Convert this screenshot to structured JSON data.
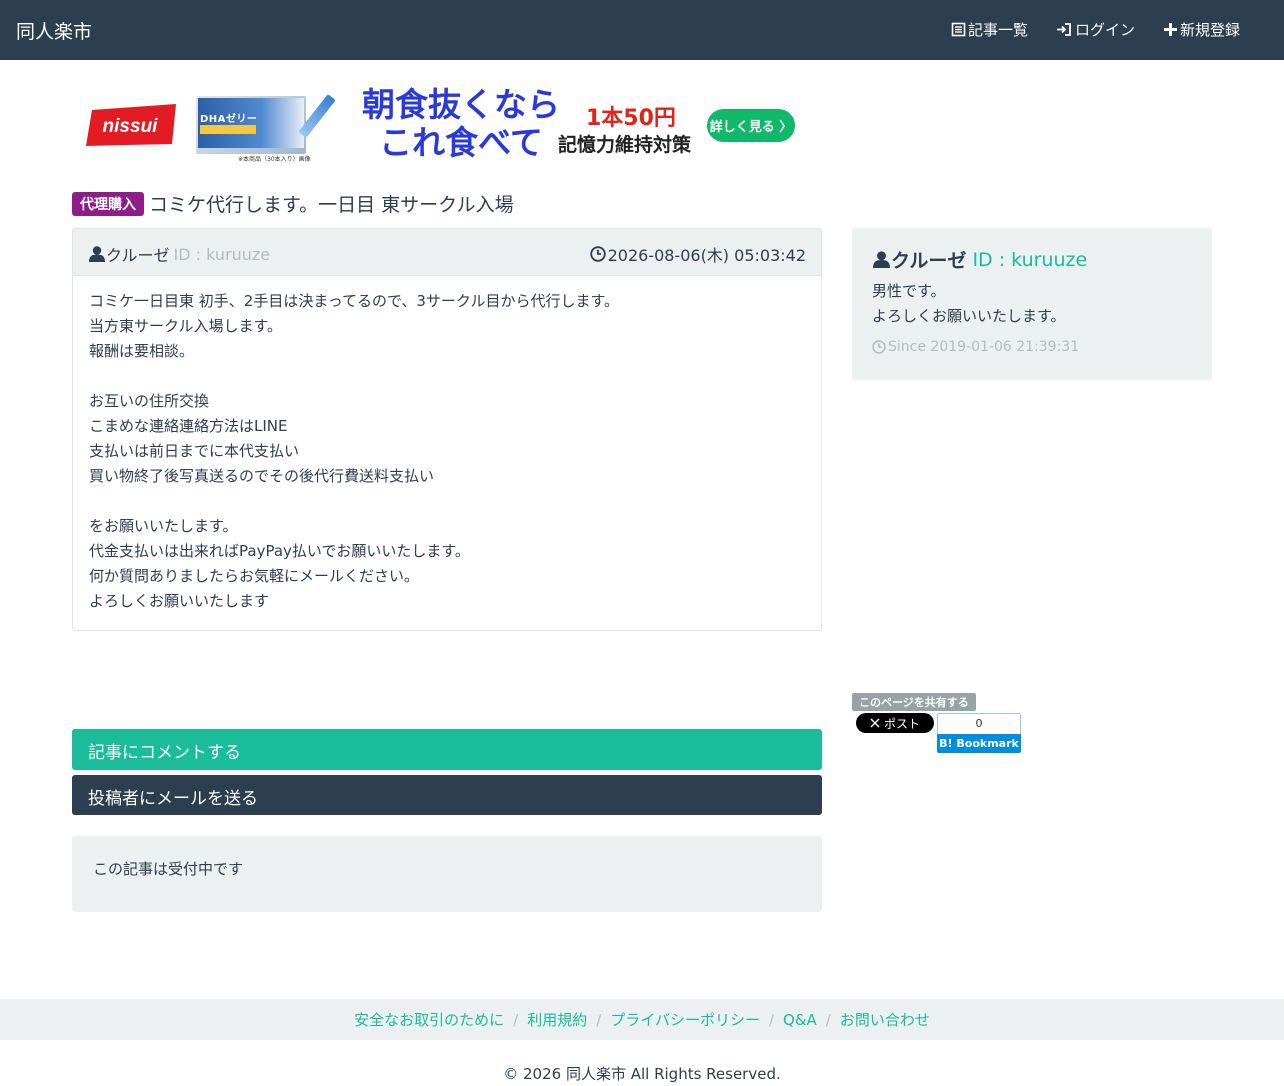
{
  "navbar": {
    "brand": "同人楽市",
    "links": [
      {
        "label": "記事一覧",
        "icon": "list-icon"
      },
      {
        "label": "ログイン",
        "icon": "login-icon"
      },
      {
        "label": "新規登録",
        "icon": "plus-icon"
      }
    ]
  },
  "ad": {
    "logo_text": "nissui",
    "product_title": "DHAゼリー",
    "product_note": "※本商品（30本入り）画像",
    "headline_line1": "朝食抜くなら",
    "headline_line2": "これ食べて",
    "price": "1本50円",
    "subline": "記憶力維持対策",
    "button": "詳しく見る 〉"
  },
  "post": {
    "category": "代理購入",
    "title": "コミケ代行します。一日目 東サークル入場",
    "author_name": "クルーゼ",
    "author_id": "ID : kuruuze",
    "datetime": "2026-08-06(木) 05:03:42",
    "body": "コミケ一日目東 初手、2手目は決まってるので、3サークル目から代行します。\n当方東サークル入場します。\n報酬は要相談。\n\nお互いの住所交換\nこまめな連絡連絡方法はLINE\n支払いは前日までに本代支払い\n買い物終了後写真送るのでその後代行費送料支払い\n\nをお願いいたします。\n代金支払いは出来ればPayPay払いでお願いいたします。\n何か質問ありましたらお気軽にメールください。\nよろしくお願いいたします"
  },
  "actions": {
    "comment": "記事にコメントする",
    "mail": "投稿者にメールを送る",
    "status": "この記事は受付中です"
  },
  "profile": {
    "name": "クルーゼ",
    "id": "ID : kuruuze",
    "bio": "男性です。\nよろしくお願いいたします。",
    "since": "Since 2019-01-06 21:39:31"
  },
  "share": {
    "label": "このページを共有する",
    "x_label": "ポスト",
    "hatena_count": "0",
    "hatena_label": "Bookmark"
  },
  "footer": {
    "links": [
      "安全なお取引のために",
      "利用規約",
      "プライバシーポリシー",
      "Q&A",
      "お問い合わせ"
    ],
    "copyright": "© 2026 同人楽市 All Rights Reserved."
  }
}
